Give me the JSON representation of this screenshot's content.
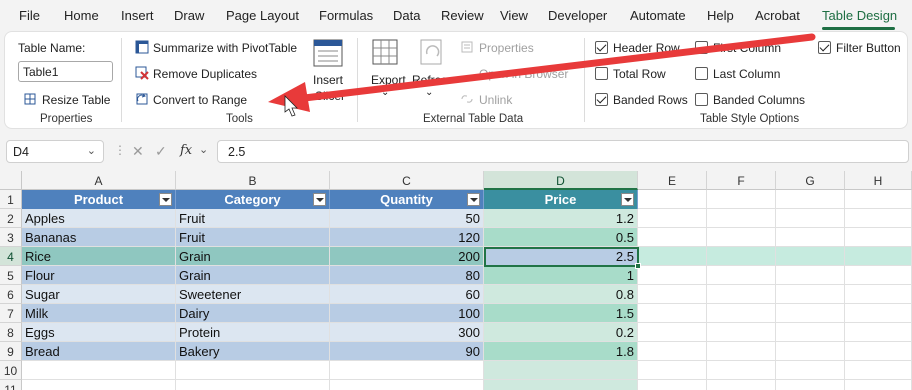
{
  "menu": {
    "tabs": [
      "File",
      "Home",
      "Insert",
      "Draw",
      "Page Layout",
      "Formulas",
      "Data",
      "Review",
      "View",
      "Developer",
      "Automate",
      "Help",
      "Acrobat",
      "Table Design"
    ],
    "active": "Table Design"
  },
  "ribbon": {
    "properties": {
      "table_name_label": "Table Name:",
      "table_name_value": "Table1",
      "resize_label": "Resize Table",
      "group_label": "Properties"
    },
    "tools": {
      "summarize_label": "Summarize with PivotTable",
      "remove_dup_label": "Remove Duplicates",
      "convert_label": "Convert to Range",
      "insert_label": "Insert",
      "slicer_label": "Slicer",
      "group_label": "Tools"
    },
    "external": {
      "export_label": "Export",
      "refresh_label": "Refresh",
      "properties_label": "Properties",
      "open_browser_label": "Open in Browser",
      "unlink_label": "Unlink",
      "group_label": "External Table Data"
    },
    "style_options": {
      "header_row": {
        "label": "Header Row",
        "checked": true
      },
      "total_row": {
        "label": "Total Row",
        "checked": false
      },
      "banded_rows": {
        "label": "Banded Rows",
        "checked": true
      },
      "first_column": {
        "label": "First Column",
        "checked": false
      },
      "last_column": {
        "label": "Last Column",
        "checked": false
      },
      "banded_columns": {
        "label": "Banded Columns",
        "checked": false
      },
      "filter_button": {
        "label": "Filter Button",
        "checked": true
      },
      "group_label": "Table Style Options"
    }
  },
  "formula_bar": {
    "cell_ref": "D4",
    "fx": "fx",
    "value": "2.5"
  },
  "sheet": {
    "columns": [
      "A",
      "B",
      "C",
      "D",
      "E",
      "F",
      "G",
      "H"
    ],
    "selected_column": "D",
    "selected_row": "4",
    "row_numbers": [
      "1",
      "2",
      "3",
      "4",
      "5",
      "6",
      "7",
      "8",
      "9",
      "10",
      "11"
    ],
    "table_headers": [
      "Product",
      "Category",
      "Quantity",
      "Price"
    ],
    "table_rows": [
      [
        "Apples",
        "Fruit",
        "50",
        "1.2"
      ],
      [
        "Bananas",
        "Fruit",
        "120",
        "0.5"
      ],
      [
        "Rice",
        "Grain",
        "200",
        "2.5"
      ],
      [
        "Flour",
        "Grain",
        "80",
        "1"
      ],
      [
        "Sugar",
        "Sweetener",
        "60",
        "0.8"
      ],
      [
        "Milk",
        "Dairy",
        "100",
        "1.5"
      ],
      [
        "Eggs",
        "Protein",
        "300",
        "0.2"
      ],
      [
        "Bread",
        "Bakery",
        "90",
        "1.8"
      ]
    ]
  },
  "colors": {
    "accent_green": "#217346",
    "table_header_blue": "#4f81bd",
    "band_light": "#dce6f1",
    "band_dark": "#b8cce4",
    "price_band_light": "#cfe9de",
    "price_band_dark": "#a8dcc9",
    "annotation_arrow": "#e83a3a"
  }
}
